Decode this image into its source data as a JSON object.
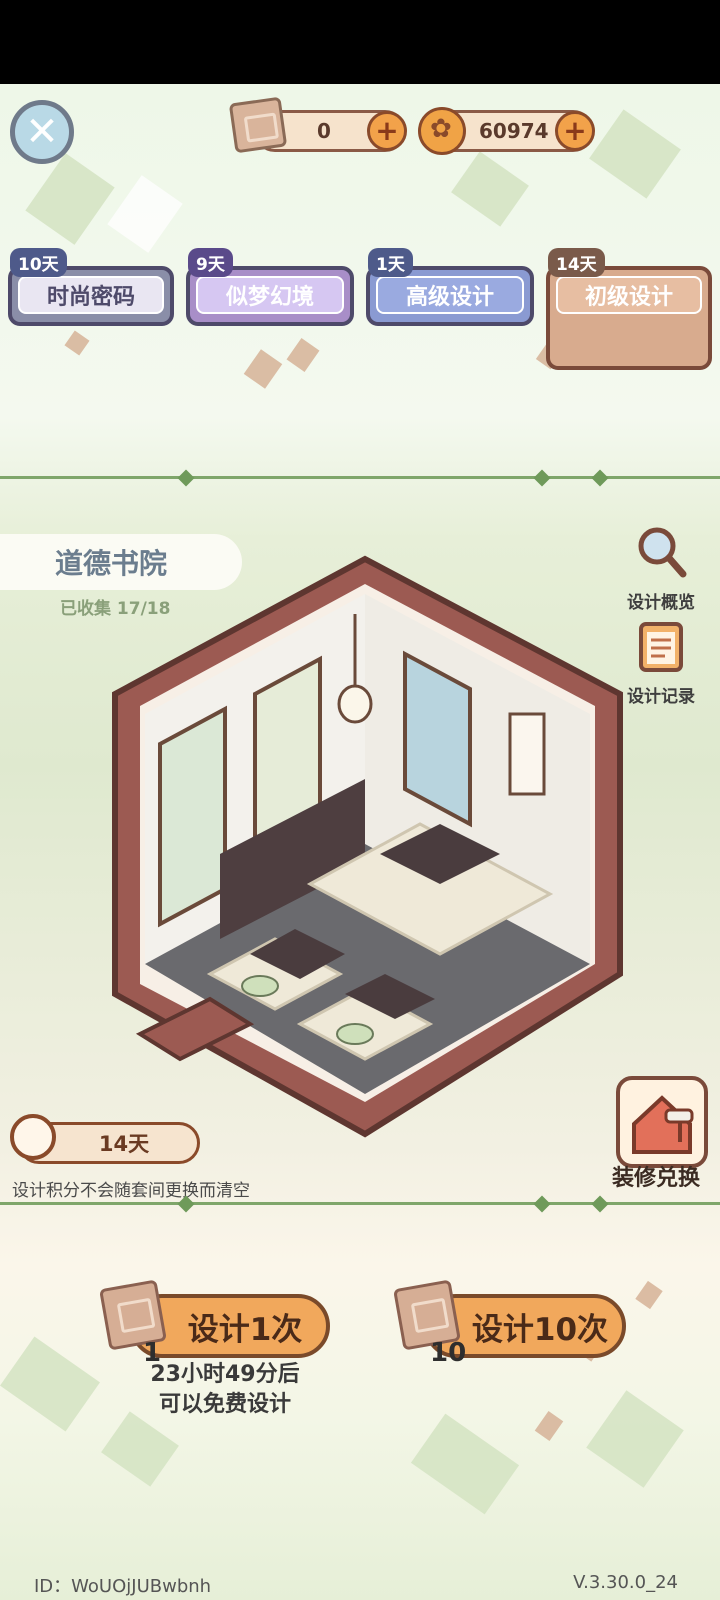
{
  "currency": {
    "scroll_value": "0",
    "coin_value": "60974"
  },
  "tabs": [
    {
      "days": "10天",
      "label": "时尚密码"
    },
    {
      "days": "9天",
      "label": "似梦幻境"
    },
    {
      "days": "1天",
      "label": "高级设计"
    },
    {
      "days": "14天",
      "label": "初级设计"
    }
  ],
  "room": {
    "name": "道德书院",
    "collected": "已收集 17/18"
  },
  "side_buttons": {
    "overview": "设计概览",
    "records": "设计记录"
  },
  "timer": {
    "remaining": "14天",
    "note": "设计积分不会随套间更换而清空"
  },
  "renovate": {
    "label": "装修兑换"
  },
  "design": {
    "single_label": "设计1次",
    "single_cost": "1",
    "ten_label": "设计10次",
    "ten_cost": "10",
    "free_note_line1": "23小时49分后",
    "free_note_line2": "可以免费设计"
  },
  "footer": {
    "id": "ID：WoUOjJUBwbnh",
    "version": "V.3.30.0_24"
  }
}
